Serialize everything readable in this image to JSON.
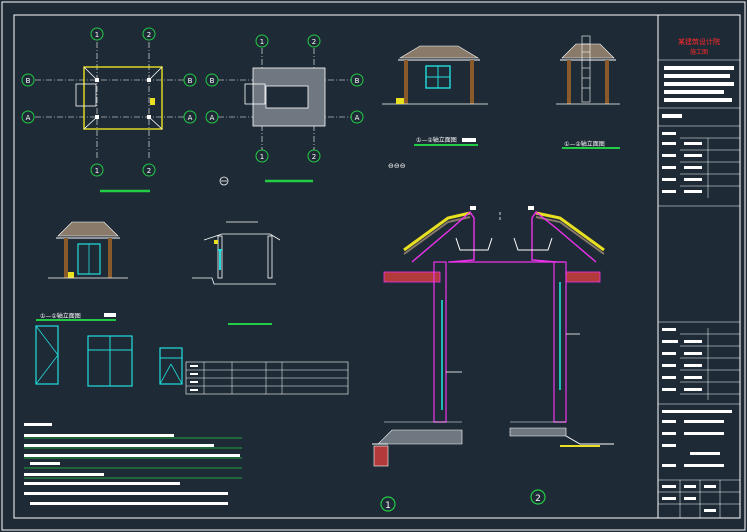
{
  "axes": {
    "one": "1",
    "two": "2",
    "a": "A",
    "b": "B"
  },
  "view_titles": {
    "front_elevation": "①—②轴立面图",
    "side_elevation": "①—②轴立面图",
    "left_elevation": "①—①轴立面图"
  },
  "scale_mark": "⊖⊖⊖",
  "section_numbers": [
    "①",
    "②"
  ],
  "title_block": {
    "firm_name": "某建筑设计院",
    "firm_sub": "施工图"
  },
  "colors": {
    "background": "#1e2a35",
    "frame": "#ffffff",
    "axis": "#22cc44",
    "window": "#22dddd",
    "section": "#ee33ee",
    "roof_tile": "#e8e020",
    "wall": "#b33a3a",
    "title_red": "#ff2a2a"
  }
}
